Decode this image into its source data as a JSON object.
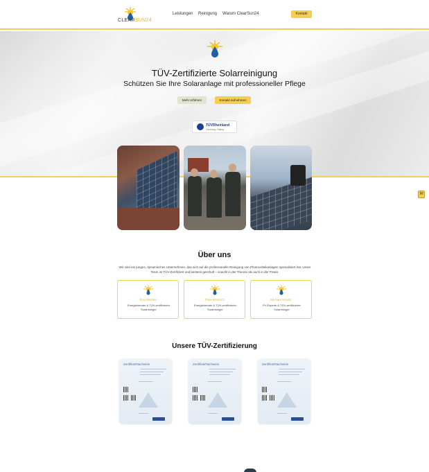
{
  "nav": {
    "logo_prefix": "CLEAR",
    "logo_suffix": "SUN24",
    "links": [
      "Leistungen",
      "Reinigung",
      "Warum ClearSun24"
    ],
    "cta": "Kontakt"
  },
  "hero": {
    "title": "TÜV-Zertifizierte Solarreinigung",
    "subtitle": "Schützen Sie Ihre Solaranlage mit professioneller Pflege",
    "btn_more": "Mehr erfahren",
    "btn_contact": "Kontakt aufnehmen",
    "badge_name": "TÜVRheinland",
    "badge_sub": "Germany, Rating"
  },
  "about": {
    "title": "Über uns",
    "text": "Wir sind ein junges, dynamisches Unternehmen, das sich auf die professionelle Reinigung von Photovoltaikanlagen spezialisiert hat. Unser Team ist TÜV-Zertifiziert und bestens geschult – sowohl in der Theorie als auch in der Praxis.",
    "cards": [
      {
        "name": "Timo Richter",
        "role": "Energieberater & TÜV-zertifizierter Solarreiniger"
      },
      {
        "name": "Thilo Weinrich",
        "role": "Energieberater & TÜV-zertifizierter Solarreiniger"
      },
      {
        "name": "Michael Scholz",
        "role": "PV-Experte & TÜV-zertifizierter Solarreiniger"
      }
    ]
  },
  "certs": {
    "title": "Unsere TÜV-Zertifizierung",
    "items": [
      {
        "heading": "Zertifikat/Nachweis"
      },
      {
        "heading": "Zertifikat/Nachweis"
      },
      {
        "heading": "Zertifikat/Nachweis"
      }
    ]
  },
  "chat": {
    "icon": "chat-icon"
  },
  "colors": {
    "accent": "#f4cf4f",
    "tuv_blue": "#1f3f8a",
    "card_border": "#f0cf5a"
  }
}
